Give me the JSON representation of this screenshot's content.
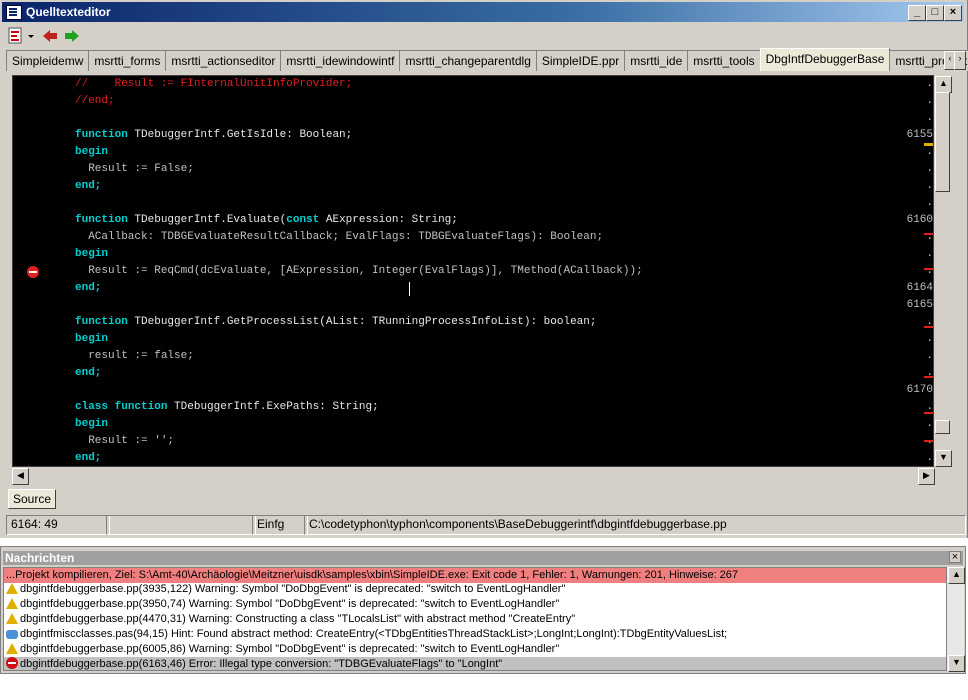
{
  "window": {
    "title": "Quelltexteditor",
    "controls": [
      "_",
      "□",
      "×"
    ]
  },
  "toolbar": {
    "icons": [
      "source-file-icon",
      "dropdown-arrow-icon",
      "back-arrow-icon",
      "forward-arrow-icon"
    ]
  },
  "tabs": [
    {
      "label": "Simpleidemw"
    },
    {
      "label": "msrtti_forms"
    },
    {
      "label": "msrtti_actionseditor"
    },
    {
      "label": "msrtti_idewindowintf"
    },
    {
      "label": "msrtti_changeparentdlg"
    },
    {
      "label": "SimpleIDE.ppr"
    },
    {
      "label": "msrtti_ide"
    },
    {
      "label": "msrtti_tools"
    },
    {
      "label": "DbgIntfDebuggerBase",
      "active": true
    },
    {
      "label": "msrtti_projectintf"
    },
    {
      "label": "m"
    }
  ],
  "editor": {
    "lines": [
      {
        "num": ".",
        "text": "//    Result := FInternalUnitInfoProvider;",
        "kind": "comment"
      },
      {
        "num": ".",
        "text": "//end;",
        "kind": "comment"
      },
      {
        "num": ".",
        "text": "",
        "kind": "plain"
      },
      {
        "num": "6155",
        "text": "function TDebuggerIntf.GetIsIdle: Boolean;",
        "kind": "function"
      },
      {
        "num": ".",
        "text": "begin",
        "kind": "keyword"
      },
      {
        "num": ".",
        "text": "  Result := False;",
        "kind": "plain"
      },
      {
        "num": ".",
        "text": "end;",
        "kind": "keyword"
      },
      {
        "num": ".",
        "text": "",
        "kind": "plain"
      },
      {
        "num": "6160",
        "text": "function TDebuggerIntf.Evaluate(const AExpression: String;",
        "kind": "function"
      },
      {
        "num": ".",
        "text": "  ACallback: TDBGEvaluateResultCallback; EvalFlags: TDBGEvaluateFlags): Boolean;",
        "kind": "plain"
      },
      {
        "num": ".",
        "text": "begin",
        "kind": "keyword"
      },
      {
        "num": ".",
        "text": "  Result := ReqCmd(dcEvaluate, [AExpression, Integer(EvalFlags)], TMethod(ACallback));",
        "kind": "plain"
      },
      {
        "num": "6164",
        "text": "end;",
        "kind": "keyword"
      },
      {
        "num": "6165",
        "text": "",
        "kind": "plain"
      },
      {
        "num": ".",
        "text": "function TDebuggerIntf.GetProcessList(AList: TRunningProcessInfoList): boolean;",
        "kind": "function"
      },
      {
        "num": ".",
        "text": "begin",
        "kind": "keyword"
      },
      {
        "num": ".",
        "text": "  result := false;",
        "kind": "plain"
      },
      {
        "num": ".",
        "text": "end;",
        "kind": "keyword"
      },
      {
        "num": "6170",
        "text": "",
        "kind": "plain"
      },
      {
        "num": ".",
        "text": "class function TDebuggerIntf.ExePaths: String;",
        "kind": "function"
      },
      {
        "num": ".",
        "text": "begin",
        "kind": "keyword"
      },
      {
        "num": ".",
        "text": "  Result := '';",
        "kind": "plain"
      },
      {
        "num": ".",
        "text": "end;",
        "kind": "keyword"
      }
    ]
  },
  "source_tab": "Source",
  "statusbar": {
    "position": "6164: 49",
    "modified": "",
    "mode": "Einfg",
    "file": "C:\\codetyphon\\typhon\\components\\BaseDebuggerintf\\dbgintfdebuggerbase.pp"
  },
  "messages": {
    "title": "Nachrichten",
    "close": "×",
    "items": [
      {
        "type": "header",
        "text": "...Projekt kompilieren, Ziel: S:\\Amt-40\\Archäologie\\Meitzner\\uisdk\\samples\\xbin\\SimpleIDE.exe: Exit code 1, Fehler: 1, Warnungen: 201, Hinweise: 267"
      },
      {
        "type": "warning",
        "text": "dbgintfdebuggerbase.pp(3935,122) Warning: Symbol \"DoDbgEvent\" is deprecated: \"switch to EventLogHandler\""
      },
      {
        "type": "warning",
        "text": "dbgintfdebuggerbase.pp(3950,74) Warning: Symbol \"DoDbgEvent\" is deprecated: \"switch to EventLogHandler\""
      },
      {
        "type": "warning",
        "text": "dbgintfdebuggerbase.pp(4470,31) Warning: Constructing a class \"TLocalsList\" with abstract method \"CreateEntry\""
      },
      {
        "type": "hint",
        "text": "dbgintfmiscclasses.pas(94,15) Hint: Found abstract method: CreateEntry(<TDbgEntitiesThreadStackList>;LongInt;LongInt):TDbgEntityValuesList;"
      },
      {
        "type": "warning",
        "text": "dbgintfdebuggerbase.pp(6005,86) Warning: Symbol \"DoDbgEvent\" is deprecated: \"switch to EventLogHandler\""
      },
      {
        "type": "error",
        "text": "dbgintfdebuggerbase.pp(6163,46) Error: Illegal type conversion: \"TDBGEvaluateFlags\" to \"LongInt\""
      }
    ]
  }
}
